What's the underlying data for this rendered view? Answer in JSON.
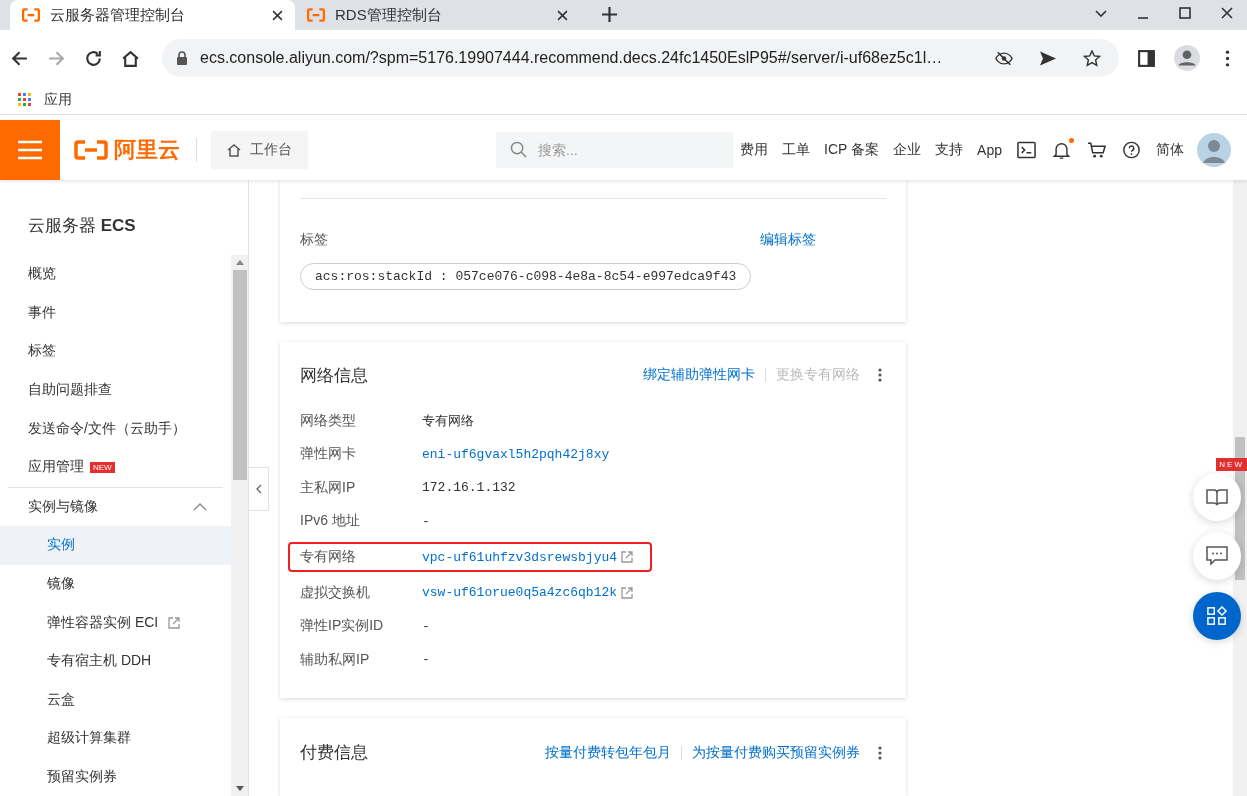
{
  "browser": {
    "tabs": [
      {
        "title": "云服务器管理控制台",
        "selected": true
      },
      {
        "title": "RDS管理控制台",
        "selected": false
      }
    ],
    "url": "ecs.console.aliyun.com/?spm=5176.19907444.recommend.decs.24fc1450EslP95#/server/i-uf68ez5c1l…",
    "bookmarks": [
      "应用"
    ]
  },
  "header": {
    "logo": "阿里云",
    "workbench": "工作台",
    "search": {
      "placeholder": "搜索..."
    },
    "nav": [
      "费用",
      "工单",
      "ICP 备案",
      "企业",
      "支持",
      "App"
    ],
    "notification_dot": true,
    "language": "简体"
  },
  "sidebar": {
    "title": "云服务器 **ECS**",
    "items": [
      {
        "kind": "item",
        "label": "概览",
        "selected": false
      },
      {
        "kind": "item",
        "label": "事件",
        "selected": false
      },
      {
        "kind": "item",
        "label": "标签",
        "selected": false
      },
      {
        "kind": "item",
        "label": "自助问题排查",
        "selected": false
      },
      {
        "kind": "item",
        "label": "发送命令/文件（云助手）",
        "selected": false
      },
      {
        "kind": "item",
        "label": "应用管理",
        "badge": "NEW",
        "selected": false
      },
      {
        "kind": "group",
        "label": "实例与镜像",
        "expanded": true,
        "selected": false,
        "children": [
          {
            "label": "实例",
            "selected": true
          },
          {
            "label": "镜像",
            "selected": false
          },
          {
            "label": "弹性容器实例 ECI",
            "external": true,
            "selected": false
          },
          {
            "label": "专有宿主机 DDH",
            "selected": false
          },
          {
            "label": "云盒",
            "selected": false
          },
          {
            "label": "超级计算集群",
            "selected": false
          },
          {
            "label": "预留实例券",
            "selected": false
          }
        ]
      }
    ]
  },
  "tags_card": {
    "label": "标签",
    "action": "编辑标签",
    "tags": [
      "acs:ros:stackId : 057ce076-c098-4e8a-8c54-e997edca9f43"
    ]
  },
  "network_card": {
    "title": "网络信息",
    "actions": [
      {
        "label": "绑定辅助弹性网卡",
        "disabled": false
      },
      {
        "label": "更换专有网络",
        "disabled": true
      }
    ],
    "rows": [
      {
        "label": "网络类型",
        "value": "专有网络",
        "kind": "text",
        "highlighted": false
      },
      {
        "label": "弹性网卡",
        "value": "eni-uf6gvaxl5h2pqh42j8xy",
        "kind": "link",
        "highlighted": false
      },
      {
        "label": "主私网IP",
        "value": "172.16.1.132",
        "kind": "text",
        "highlighted": false
      },
      {
        "label": "IPv6 地址",
        "value": "-",
        "kind": "text",
        "highlighted": false
      },
      {
        "label": "专有网络",
        "value": "vpc-uf61uhfzv3dsrewsbjyu4",
        "kind": "external_link",
        "highlighted": true
      },
      {
        "label": "虚拟交换机",
        "value": "vsw-uf61orue0q5a4zc6qb12k",
        "kind": "external_link",
        "highlighted": false
      },
      {
        "label": "弹性IP实例ID",
        "value": "-",
        "kind": "text",
        "highlighted": false
      },
      {
        "label": "辅助私网IP",
        "value": "-",
        "kind": "text",
        "highlighted": false
      }
    ]
  },
  "billing_card": {
    "title": "付费信息",
    "actions": [
      {
        "label": "按量付费转包年包月",
        "disabled": false
      },
      {
        "label": "为按量付费购买预留实例券",
        "disabled": false
      }
    ]
  },
  "floating": {
    "badge": "NEW"
  }
}
